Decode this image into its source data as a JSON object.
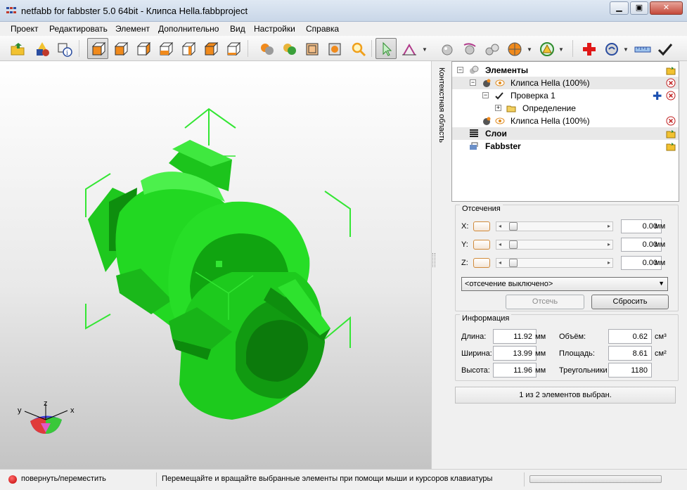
{
  "window": {
    "title": "netfabb for fabbster 5.0 64bit - Клипса Hella.fabbproject",
    "minimize_label": "▁",
    "maximize_label": "▣",
    "close_label": "✕"
  },
  "menu": [
    "Проект",
    "Редактировать",
    "Элемент",
    "Дополнительно",
    "Вид",
    "Настройки",
    "Справка"
  ],
  "toolbar": {
    "icons": [
      "open-project-icon",
      "add-part-icon",
      "part-info-icon",
      "view-iso-icon",
      "view-front-icon",
      "view-back-icon",
      "view-left-icon",
      "view-right-icon",
      "view-top-icon",
      "view-bottom-icon",
      "shading-icon",
      "textured-icon",
      "wireframe-icon",
      "bounding-box-icon",
      "zoom-icon",
      "select-pointer-icon",
      "measure-icon",
      "sphere-icon",
      "rotate-icon",
      "multi-spheres-icon",
      "color-icon",
      "repair-icon",
      "add-red-cross-icon",
      "analysis-icon",
      "ruler-icon",
      "check-icon"
    ],
    "active": "view-iso-icon",
    "pointer_active": true
  },
  "context_label": "Контекстная область",
  "tree": {
    "rows": [
      {
        "label": "Элементы",
        "bold": true
      },
      {
        "label": "Клипса Hella (100%)",
        "bold": false,
        "selected": true
      },
      {
        "label": "Проверка 1",
        "bold": false
      },
      {
        "label": "Определение",
        "bold": false
      },
      {
        "label": "Клипса Hella (100%)",
        "bold": false
      },
      {
        "label": "Слои",
        "bold": true,
        "selected": true
      },
      {
        "label": "Fabbster",
        "bold": true
      }
    ]
  },
  "clipping": {
    "title": "Отсечения",
    "axes": [
      {
        "label": "X:",
        "value": "0.00",
        "unit": "мм"
      },
      {
        "label": "Y:",
        "value": "0.00",
        "unit": "мм"
      },
      {
        "label": "Z:",
        "value": "0.00",
        "unit": "мм"
      }
    ],
    "mode": "<отсечение выключено>",
    "clip_button": "Отсечь",
    "reset_button": "Сбросить"
  },
  "info": {
    "title": "Информация",
    "length_label": "Длина:",
    "length_value": "11.92",
    "length_unit": "мм",
    "width_label": "Ширина:",
    "width_value": "13.99",
    "width_unit": "мм",
    "height_label": "Высота:",
    "height_value": "11.96",
    "height_unit": "мм",
    "volume_label": "Объём:",
    "volume_value": "0.62",
    "volume_unit": "см³",
    "area_label": "Площадь:",
    "area_value": "8.61",
    "area_unit": "см²",
    "triangles_label": "Треугольники",
    "triangles_value": "1180"
  },
  "selection_status": "1 из 2 элементов выбран.",
  "axes_gizmo": {
    "x": "x",
    "y": "y",
    "z": "z"
  },
  "status": {
    "mode": "повернуть/переместить",
    "hint": "Перемещайте и вращайте выбранные элементы при помощи мыши и курсоров клавиатуры"
  },
  "colors": {
    "model": "#22d822",
    "model_dark": "#0c9a0c",
    "gizmo": "#33e633"
  }
}
